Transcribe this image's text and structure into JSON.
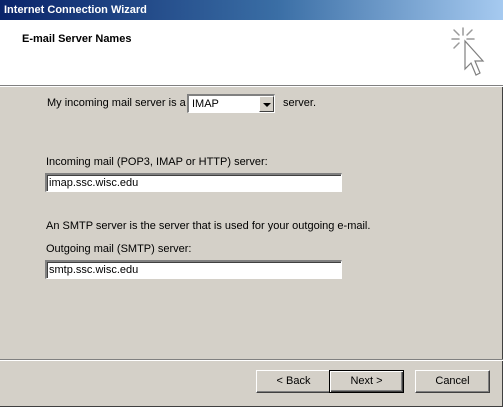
{
  "window": {
    "title": "Internet Connection Wizard"
  },
  "header": {
    "title": "E-mail Server Names",
    "icon": "wizard-sparkle-cursor-icon"
  },
  "incoming_type": {
    "prefix": "My incoming mail server is a",
    "selected": "IMAP",
    "suffix": "server."
  },
  "incoming_server": {
    "label": "Incoming mail (POP3, IMAP or HTTP) server:",
    "value": "imap.ssc.wisc.edu"
  },
  "smtp_note": "An SMTP server is the server that is used for your outgoing e-mail.",
  "outgoing_server": {
    "label": "Outgoing mail (SMTP) server:",
    "value": "smtp.ssc.wisc.edu"
  },
  "buttons": {
    "back": "< Back",
    "next": "Next >",
    "cancel": "Cancel"
  },
  "colors": {
    "titlebar_start": "#0a246a",
    "titlebar_end": "#a6caf0",
    "face": "#d4d0c8",
    "header_bg": "#ffffff"
  }
}
